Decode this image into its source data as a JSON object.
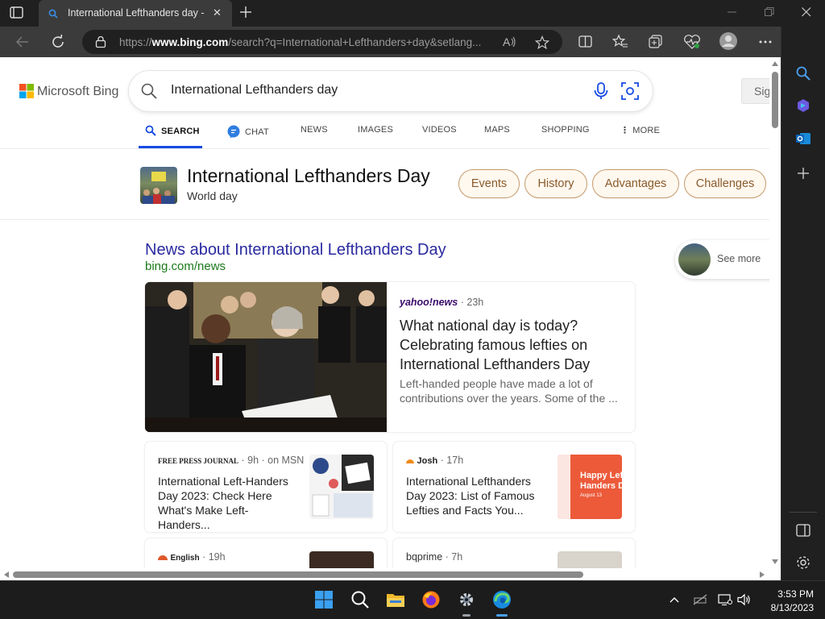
{
  "browser": {
    "tab": {
      "title": "International Lefthanders day - S"
    },
    "address": {
      "url_prefix": "https://",
      "url_domain": "www.bing.com",
      "url_rest": "/search?q=International+Lefthanders+day&setlang..."
    }
  },
  "bing": {
    "logo_text": "Microsoft Bing",
    "query": "International Lefthanders day",
    "signin_label": "Sig",
    "tabs": [
      {
        "label": "SEARCH"
      },
      {
        "label": "CHAT"
      },
      {
        "label": "NEWS"
      },
      {
        "label": "IMAGES"
      },
      {
        "label": "VIDEOS"
      },
      {
        "label": "MAPS"
      },
      {
        "label": "SHOPPING"
      },
      {
        "label": "MORE"
      }
    ]
  },
  "entity": {
    "title": "International Lefthanders Day",
    "subtitle": "World day",
    "pills": [
      "Events",
      "History",
      "Advantages",
      "Challenges"
    ]
  },
  "news": {
    "heading": "News about International Lefthanders Day",
    "source": "bing.com/news",
    "see_more": "See more",
    "main": {
      "publisher": "yahoo!news",
      "age": "· 23h",
      "title": "What national day is today? Celebrating famous lefties on International Lefthanders Day",
      "snippet": "Left-handed people have made a lot of contributions over the years. Some of the ..."
    },
    "cards": [
      {
        "publisher": "FREE PRESS JOURNAL",
        "age": "· 9h · on MSN",
        "title": "International Left-Handers Day 2023: Check Here What's Make Left-Handers..."
      },
      {
        "publisher": "Josh",
        "age": "· 17h",
        "title": "International Lefthanders Day 2023: List of Famous Lefties and Facts You...",
        "thumb_text": "Happy Left Handers D",
        "thumb_sub": "August 13"
      },
      {
        "publisher": "English",
        "age": "· 19h",
        "title": ""
      },
      {
        "publisher": "bqprime",
        "age": "· 7h",
        "title": ""
      }
    ]
  },
  "taskbar": {
    "time": "3:53 PM",
    "date": "8/13/2023"
  },
  "colors": {
    "accent": "#174ae4",
    "link": "#2a2aa0",
    "url_green": "#1a7a1a",
    "pill_border": "#c49a6c"
  }
}
